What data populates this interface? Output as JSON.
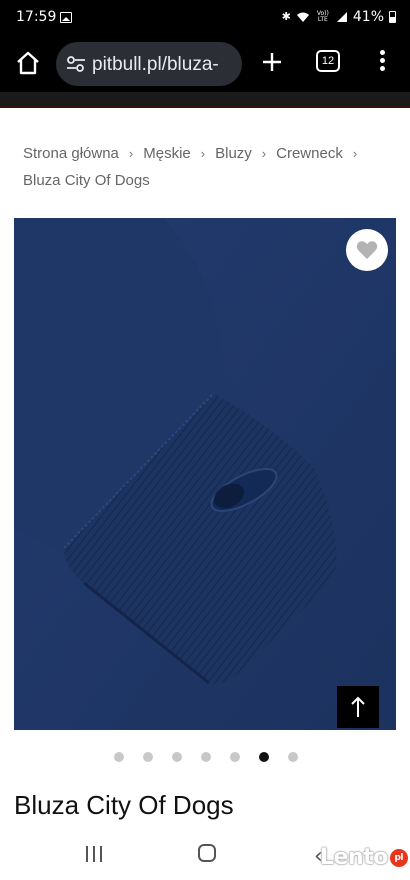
{
  "status_bar": {
    "time": "17:59",
    "lte": "Vo)) LTE",
    "battery": "41%"
  },
  "browser": {
    "url": "pitbull.pl/bluza-",
    "tab_count": "12",
    "icons": [
      "home-icon",
      "tune-icon",
      "plus-icon",
      "tabs-icon",
      "more-vert-icon"
    ]
  },
  "breadcrumb": {
    "items": [
      "Strona główna",
      "Męskie",
      "Bluzy",
      "Crewneck"
    ],
    "current": "Bluza City Of Dogs",
    "separator": "›"
  },
  "gallery": {
    "image_color": "#1e3566",
    "dot_count": 7,
    "active_dot_index": 5
  },
  "product": {
    "title": "Bluza City Of Dogs"
  },
  "system_nav": {
    "icons": [
      "recents-icon",
      "home-icon",
      "back-icon"
    ]
  },
  "watermark": {
    "text": "Lento",
    "badge": "pl"
  }
}
